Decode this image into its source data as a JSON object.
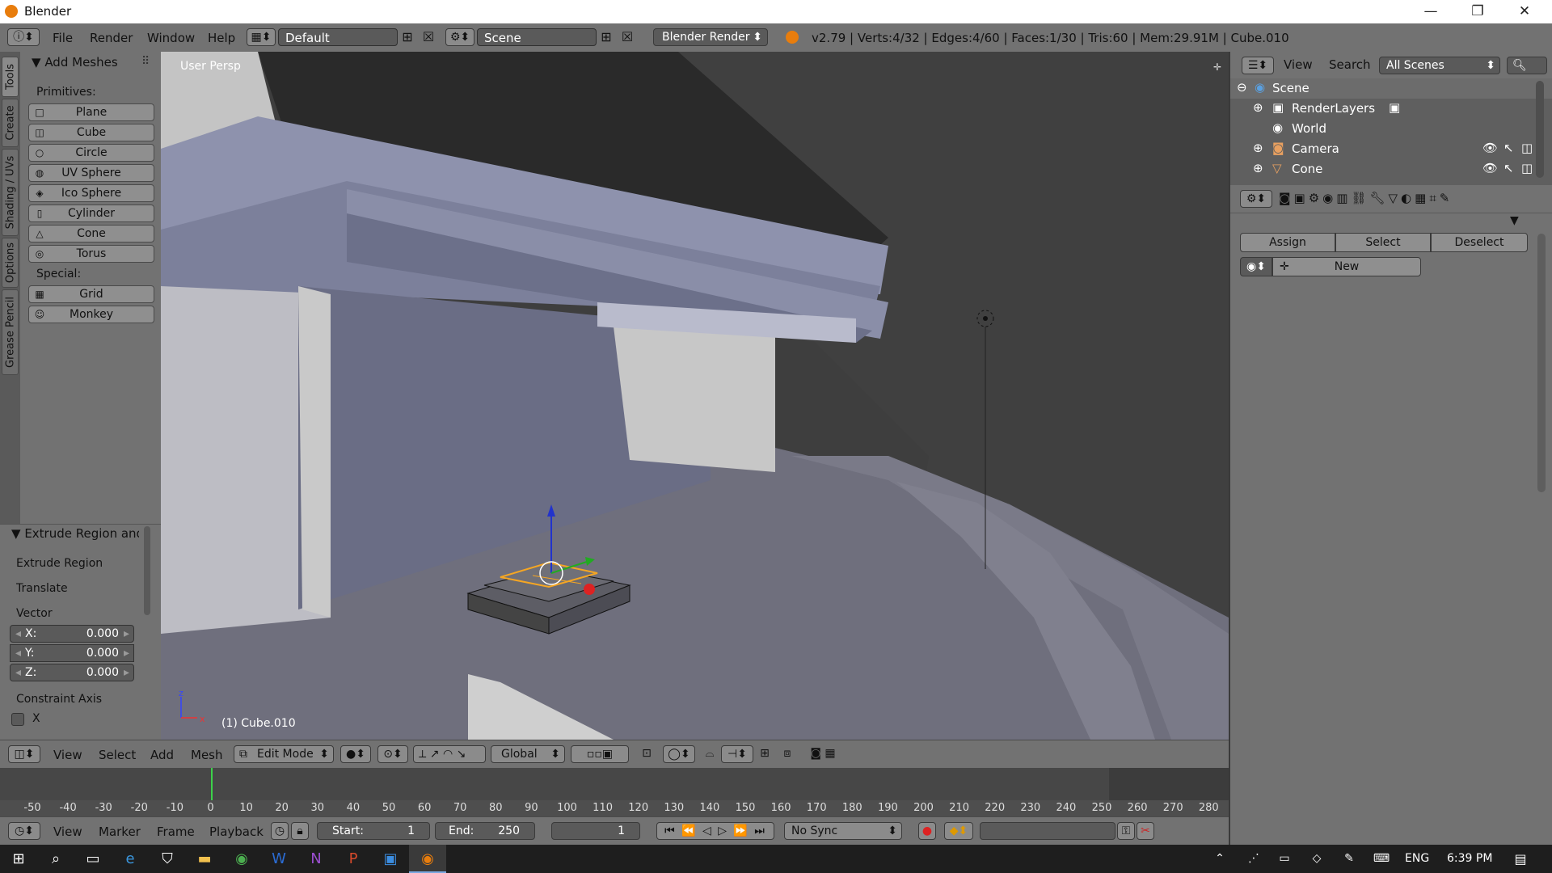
{
  "window": {
    "title": "Blender",
    "minimize": "—",
    "maximize": "❐",
    "close": "✕"
  },
  "menubar": {
    "items": [
      "File",
      "Render",
      "Window",
      "Help"
    ],
    "screen_layout": "Default",
    "scene": "Scene",
    "engine": "Blender Render",
    "stats": "v2.79 | Verts:4/32 | Edges:4/60 | Faces:1/30 | Tris:60 | Mem:29.91M | Cube.010"
  },
  "tabs": [
    "Tools",
    "Create",
    "Shading / UVs",
    "Options",
    "Grease Pencil"
  ],
  "toolshelf": {
    "panel_title": "Add Meshes",
    "primitives_label": "Primitives:",
    "primitives": [
      "Plane",
      "Cube",
      "Circle",
      "UV Sphere",
      "Ico Sphere",
      "Cylinder",
      "Cone",
      "Torus"
    ],
    "special_label": "Special:",
    "special": [
      "Grid",
      "Monkey"
    ]
  },
  "operator": {
    "title": "Extrude Region and",
    "rows": [
      "Extrude Region",
      "Translate"
    ],
    "vector_label": "Vector",
    "vector": [
      {
        "label": "X:",
        "value": "0.000"
      },
      {
        "label": "Y:",
        "value": "0.000"
      },
      {
        "label": "Z:",
        "value": "0.000"
      }
    ],
    "constraint_label": "Constraint Axis",
    "constraint_x": "X"
  },
  "viewport": {
    "view_name": "User Persp",
    "object_label": "(1) Cube.010"
  },
  "header3d": {
    "menus": [
      "View",
      "Select",
      "Add",
      "Mesh"
    ],
    "mode": "Edit Mode",
    "orientation": "Global"
  },
  "timeline": {
    "ticks": [
      -50,
      -40,
      -30,
      -20,
      -10,
      0,
      10,
      20,
      30,
      40,
      50,
      60,
      70,
      80,
      90,
      100,
      110,
      120,
      130,
      140,
      150,
      160,
      170,
      180,
      190,
      200,
      210,
      220,
      230,
      240,
      250,
      260,
      270,
      280
    ],
    "current_frame": 0,
    "menus": [
      "View",
      "Marker",
      "Frame",
      "Playback"
    ],
    "start_label": "Start:",
    "start": "1",
    "end_label": "End:",
    "end": "250",
    "frame": "1",
    "sync": "No Sync"
  },
  "outliner": {
    "menus": [
      "View",
      "Search"
    ],
    "filter": "All Scenes",
    "items": [
      "Scene",
      "RenderLayers",
      "World",
      "Camera",
      "Cone"
    ]
  },
  "properties": {
    "assign": "Assign",
    "select": "Select",
    "deselect": "Deselect",
    "new": "New"
  },
  "taskbar": {
    "lang": "ENG",
    "time": "6:39 PM"
  },
  "colors": {
    "accent": "#e87d0d",
    "panel": "#727272",
    "viewport": "#444444",
    "selection": "#f5a623"
  }
}
